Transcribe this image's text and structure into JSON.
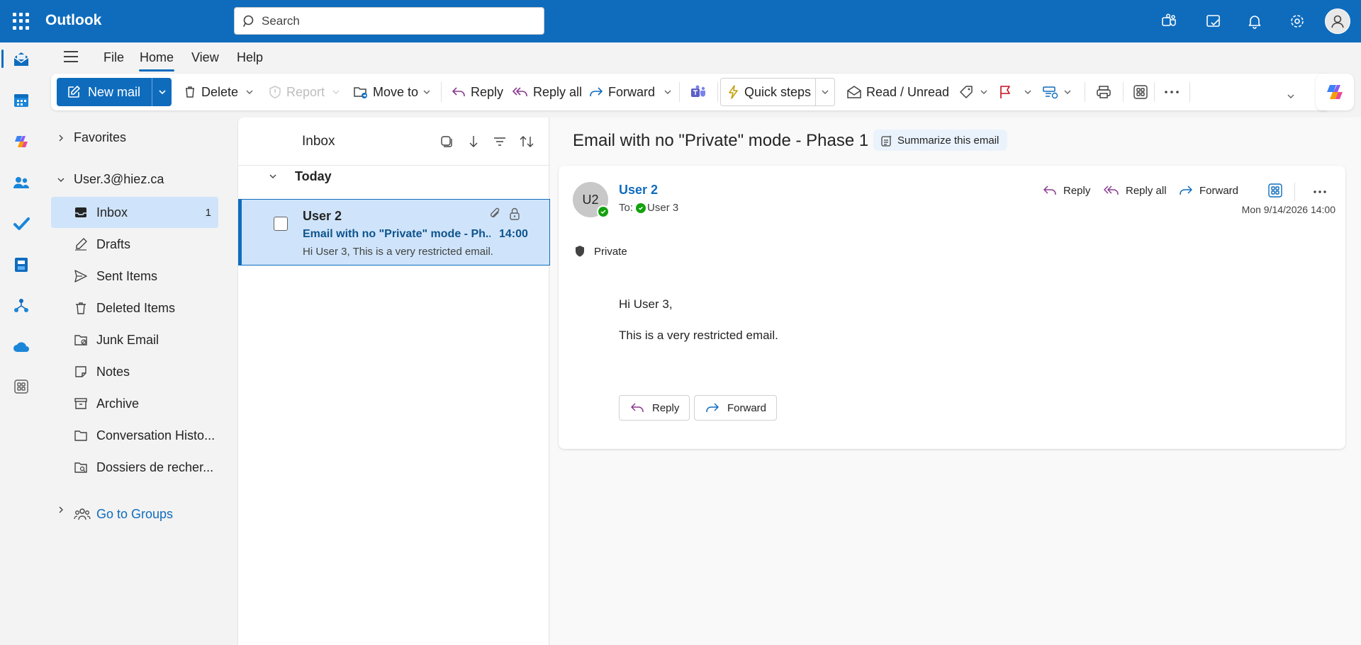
{
  "app": {
    "name": "Outlook",
    "search_placeholder": "Search"
  },
  "tabs": [
    {
      "label": "File"
    },
    {
      "label": "Home"
    },
    {
      "label": "View"
    },
    {
      "label": "Help"
    }
  ],
  "ribbon": {
    "new_mail": "New mail",
    "delete": "Delete",
    "report": "Report",
    "move_to": "Move to",
    "reply": "Reply",
    "reply_all": "Reply all",
    "forward": "Forward",
    "quick_steps": "Quick steps",
    "read_unread": "Read / Unread"
  },
  "folders": {
    "favorites": "Favorites",
    "account": "User.3@hiez.ca",
    "items": [
      {
        "label": "Inbox",
        "count": "1"
      },
      {
        "label": "Drafts"
      },
      {
        "label": "Sent Items"
      },
      {
        "label": "Deleted Items"
      },
      {
        "label": "Junk Email"
      },
      {
        "label": "Notes"
      },
      {
        "label": "Archive"
      },
      {
        "label": "Conversation Histo..."
      },
      {
        "label": "Dossiers de recher..."
      }
    ],
    "groups": "Go to Groups"
  },
  "message_list": {
    "title": "Inbox",
    "group": "Today",
    "messages": [
      {
        "from": "User 2",
        "subject": "Email with no \"Private\" mode - Ph...",
        "time": "14:00",
        "preview": "Hi User 3, This is a very restricted email."
      }
    ]
  },
  "reading": {
    "subject": "Email with no \"Private\" mode - Phase 1",
    "summarize": "Summarize this email",
    "sender_initials": "U2",
    "sender": "User 2",
    "to_label": "To:",
    "to": "User 3",
    "reply": "Reply",
    "reply_all": "Reply all",
    "forward": "Forward",
    "date": "Mon 9/14/2026 14:00",
    "sensitivity": "Private",
    "body": [
      "Hi User 3,",
      "This is a very restricted email."
    ],
    "quick_reply": "Reply",
    "quick_forward": "Forward"
  },
  "colors": {
    "brand": "#0f6cbd",
    "selected": "#cfe4fa",
    "presence": "#13a10e"
  }
}
